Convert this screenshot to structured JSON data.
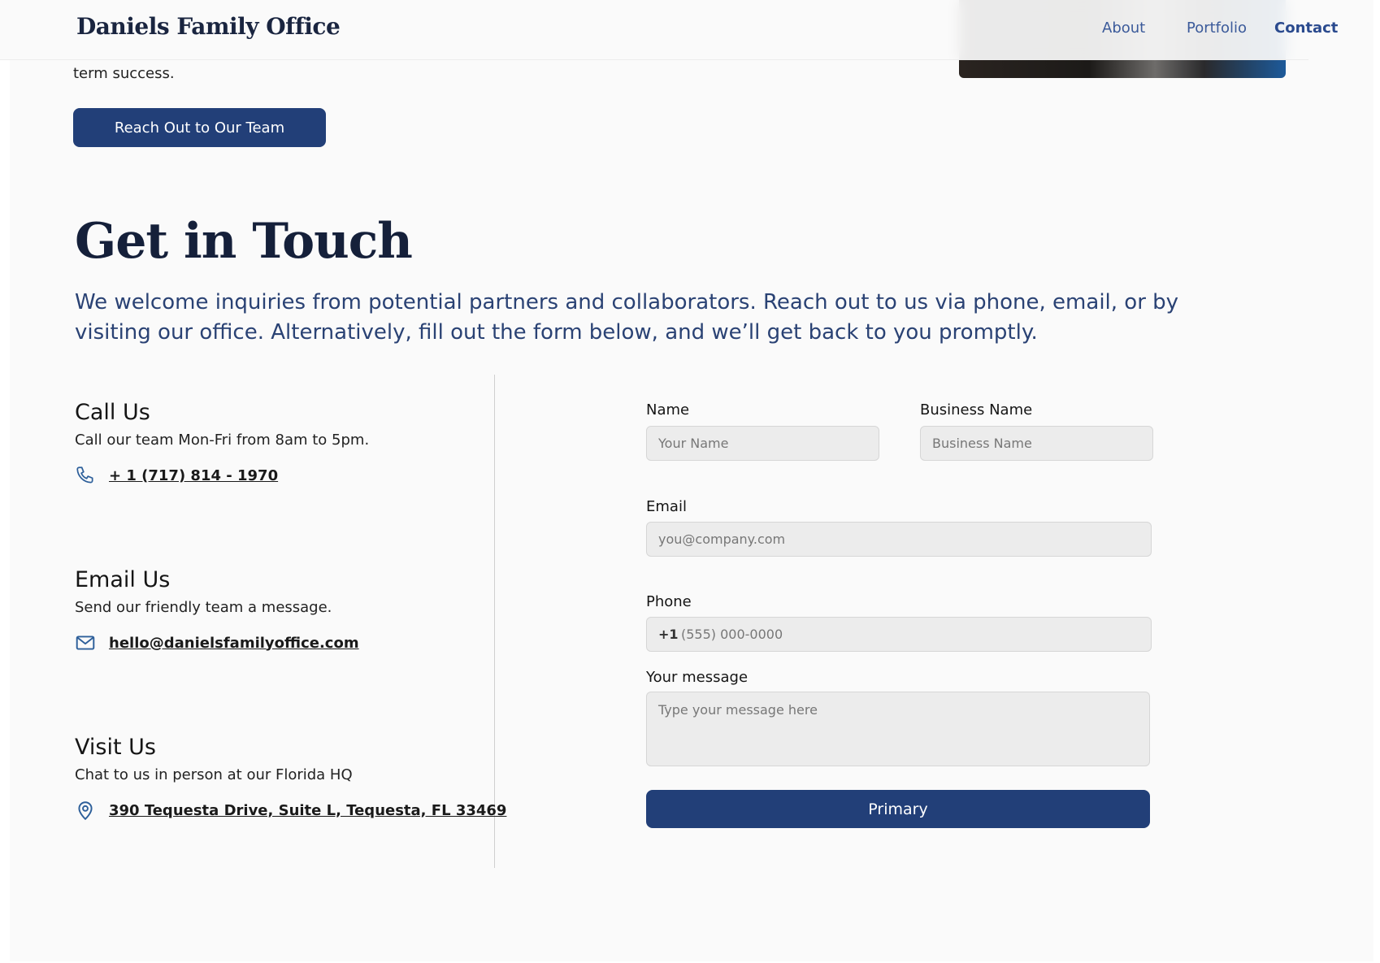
{
  "header": {
    "logo": "Daniels Family Office",
    "nav": [
      {
        "label": "About"
      },
      {
        "label": "Portfolio"
      },
      {
        "label": "Contact",
        "active": true
      }
    ]
  },
  "hero": {
    "text_tail": "term success.",
    "cta_label": "Reach Out to Our Team"
  },
  "contact": {
    "title": "Get in Touch",
    "lead": "We welcome inquiries from potential partners and collaborators. Reach out to us via phone, email, or by visiting our office. Alternatively, fill out the form below, and we’ll get back to you promptly.",
    "call": {
      "heading": "Call Us",
      "text": "Call our team Mon-Fri from 8am to 5pm.",
      "link": "+ 1 (717) 814 - 1970",
      "icon": "phone-icon"
    },
    "email": {
      "heading": "Email Us",
      "text": "Send our friendly team a message.",
      "link": "hello@danielsfamilyoffice.com",
      "icon": "mail-icon"
    },
    "visit": {
      "heading": "Visit Us",
      "text": "Chat to us in person at our Florida HQ",
      "link": "390 Tequesta Drive, Suite L, Tequesta, FL 33469",
      "icon": "map-pin-icon"
    }
  },
  "form": {
    "name": {
      "label": "Name",
      "placeholder": "Your Name",
      "value": ""
    },
    "business": {
      "label": "Business Name",
      "placeholder": "Business Name",
      "value": ""
    },
    "email": {
      "label": "Email",
      "placeholder": "you@company.com",
      "value": ""
    },
    "phone": {
      "label": "Phone",
      "prefix": "+1",
      "placeholder": "(555) 000-0000",
      "value": ""
    },
    "message": {
      "label": "Your message",
      "placeholder": "Type your message here",
      "value": ""
    },
    "submit_label": "Primary"
  },
  "colors": {
    "primary": "#223f78",
    "nav": "#3b5a9a",
    "heading": "#15203a",
    "lead": "#2a4274",
    "icon": "#2d5f9a"
  }
}
